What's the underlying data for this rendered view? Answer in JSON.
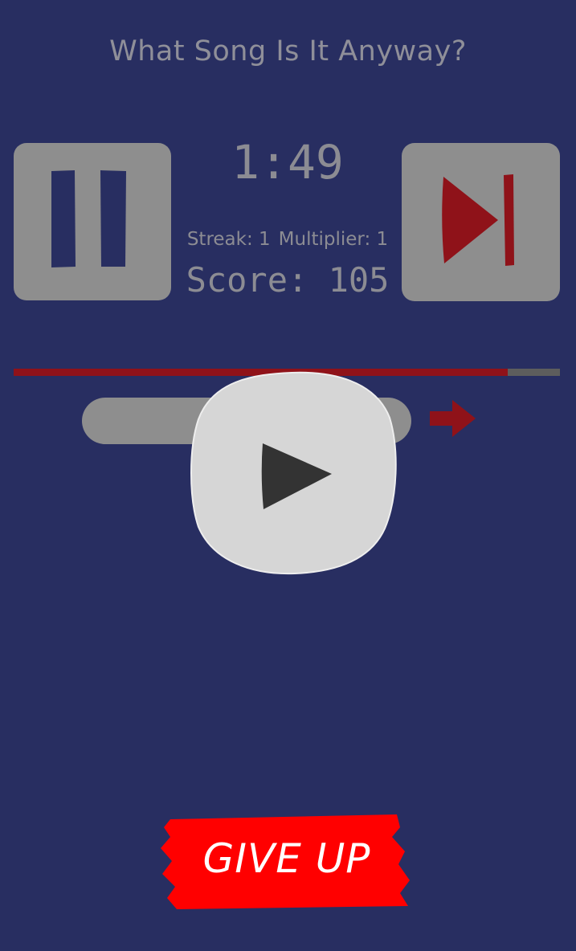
{
  "app": {
    "title": "What Song Is It Anyway?"
  },
  "player": {
    "time_remaining": "1:49",
    "pause_icon": "pause-icon",
    "skip_icon": "skip-next-icon",
    "play_icon": "play-icon",
    "song_progress_fraction": 0.905
  },
  "stats": {
    "streak": "Streak: 1",
    "multiplier": "Multiplier: 1",
    "score": "Score: 105"
  },
  "guess": {
    "input_value": "",
    "submit_icon": "arrow-right-icon"
  },
  "actions": {
    "give_up_label": "GIVE UP"
  },
  "colors": {
    "background": "#282e61",
    "button_gray": "#8e8e8e",
    "accent_red": "#8f1219",
    "give_up_red": "#ff0000",
    "text_gray": "#8c8c93"
  }
}
